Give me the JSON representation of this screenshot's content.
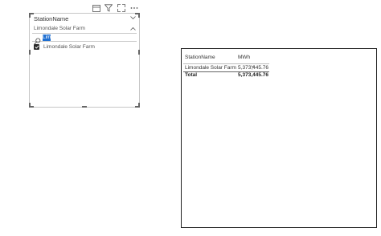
{
  "slicer": {
    "title": "StationName",
    "dropdown_value": "Limondale Solar Farm",
    "search_value": "Lim",
    "items": [
      {
        "label": "Limondale Solar Farm",
        "checked": true
      }
    ],
    "toolbar_icons": [
      "focus-mode-icon",
      "filter-icon",
      "expand-icon",
      "more-options-icon"
    ]
  },
  "table": {
    "columns": [
      "StationName",
      "MWh"
    ],
    "rows": [
      {
        "station": "Limondale Solar Farm",
        "mwh": "5,373,445.76"
      }
    ],
    "total": {
      "label": "Total",
      "mwh": "5,373,445.76"
    }
  }
}
